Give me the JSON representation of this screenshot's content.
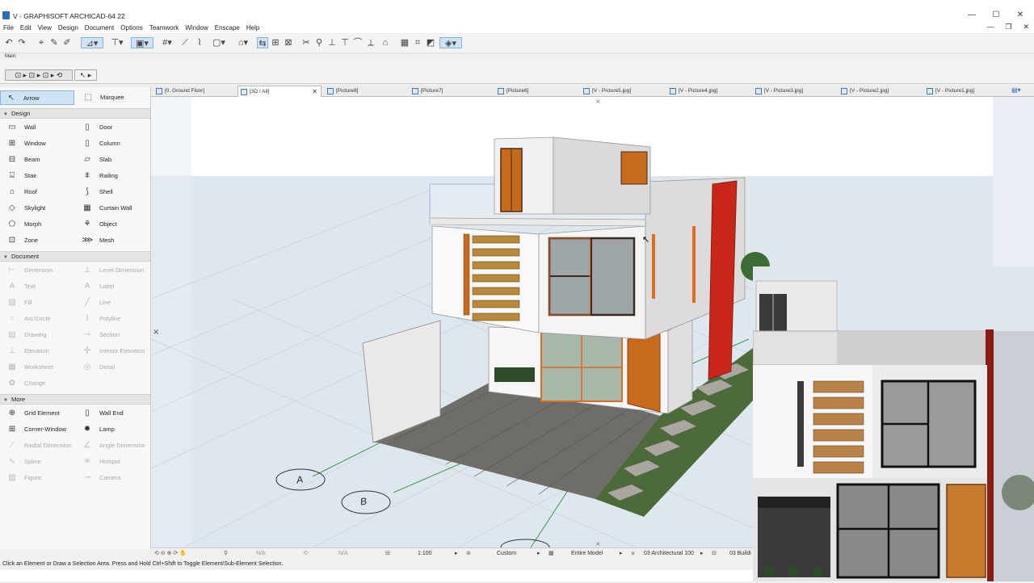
{
  "window": {
    "title": "V - GRAPHISOFT ARCHICAD-64 22",
    "min": "—",
    "max": "☐",
    "close": "✕"
  },
  "menu": [
    "File",
    "Edit",
    "View",
    "Design",
    "Document",
    "Options",
    "Teamwork",
    "Window",
    "Enscape",
    "Help"
  ],
  "mdi": {
    "min": "—",
    "restore": "❐",
    "close": "✕"
  },
  "info_box": {
    "label": "Main:"
  },
  "toolbox": {
    "arrow": "Arrow",
    "marquee": "Marquee",
    "sections": {
      "design": "Design",
      "document": "Document",
      "more": "More"
    },
    "design_tools": [
      [
        "Wall",
        "Door"
      ],
      [
        "Window",
        "Column"
      ],
      [
        "Beam",
        "Slab"
      ],
      [
        "Stair",
        "Railing"
      ],
      [
        "Roof",
        "Shell"
      ],
      [
        "Skylight",
        "Curtain Wall"
      ],
      [
        "Morph",
        "Object"
      ],
      [
        "Zone",
        "Mesh"
      ]
    ],
    "document_tools": [
      [
        "Dimension",
        "Level Dimension"
      ],
      [
        "Text",
        "Label"
      ],
      [
        "Fill",
        "Line"
      ],
      [
        "Arc/Circle",
        "Polyline"
      ],
      [
        "Drawing",
        "Section"
      ],
      [
        "Elevation",
        "Interior Elevation"
      ],
      [
        "Worksheet",
        "Detail"
      ],
      [
        "Change",
        ""
      ]
    ],
    "more_tools": [
      [
        "Grid Element",
        "Wall End"
      ],
      [
        "Corner-Window",
        "Lamp"
      ],
      [
        "Radial Dimension",
        "Angle Dimension"
      ],
      [
        "Spline",
        "Hotspot"
      ],
      [
        "Figure",
        "Camera"
      ]
    ]
  },
  "tabs": [
    "[0. Ground Floor]",
    "[3D / All]",
    "[Picture8]",
    "[Picture7]",
    "[Picture6]",
    "[V - Picture5.jpg]",
    "[V - Picture4.jpg]",
    "[V - Picture3.jpg]",
    "[V - Picture2.jpg]",
    "[V - Picture1.jpg]"
  ],
  "active_tab": "[3D / All]",
  "grid_labels": {
    "a": "A",
    "b": "B"
  },
  "view_status": {
    "na1": "N/A",
    "na2": "N/A",
    "scale": "1:100",
    "custom": "Custom",
    "model": "Entire Model",
    "pen": "03 Architectural 100",
    "layer": "03 Buildi"
  },
  "status_hint": "Click an Element or Draw a Selection Area. Press and Hold Ctrl+Shift to Toggle Element/Sub-Element Selection.",
  "colors": {
    "accent": "#cfe3f7",
    "window_frame": "#e06a1e",
    "wall": "#f4f4f4",
    "floor_stone": "#6f6d68",
    "grass": "#4c6a3a"
  }
}
